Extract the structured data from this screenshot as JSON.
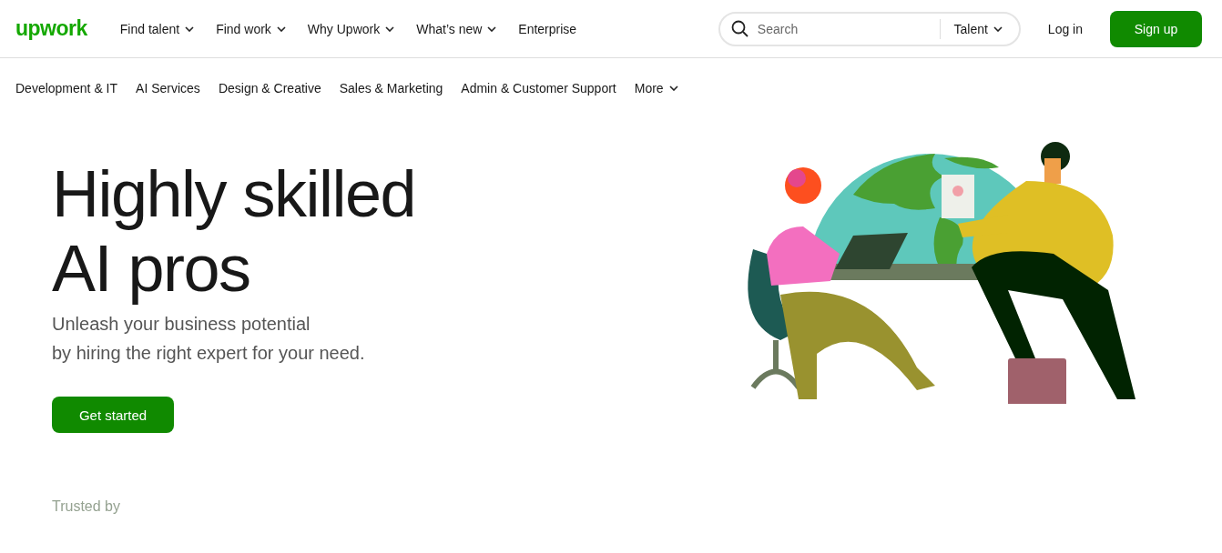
{
  "logo": "upwork",
  "top_nav": [
    {
      "label": "Find talent",
      "has_menu": true
    },
    {
      "label": "Find work",
      "has_menu": true
    },
    {
      "label": "Why Upwork",
      "has_menu": true
    },
    {
      "label": "What’s new",
      "has_menu": true
    },
    {
      "label": "Enterprise",
      "has_menu": false
    }
  ],
  "search": {
    "placeholder": "Search",
    "scope": "Talent"
  },
  "login": "Log in",
  "signup": "Sign up",
  "categories": [
    {
      "label": "Development & IT",
      "has_menu": false
    },
    {
      "label": "AI Services",
      "has_menu": false
    },
    {
      "label": "Design & Creative",
      "has_menu": false
    },
    {
      "label": "Sales & Marketing",
      "has_menu": false
    },
    {
      "label": "Admin & Customer Support",
      "has_menu": false
    },
    {
      "label": "More",
      "has_menu": true
    }
  ],
  "hero": {
    "title_lines": [
      "Highly skilled",
      "AI pros"
    ],
    "subtitle_lines": [
      "Unleash your business potential",
      "by hiring the right expert for your need."
    ],
    "cta": "Get started"
  },
  "trusted_by": "Trusted by"
}
